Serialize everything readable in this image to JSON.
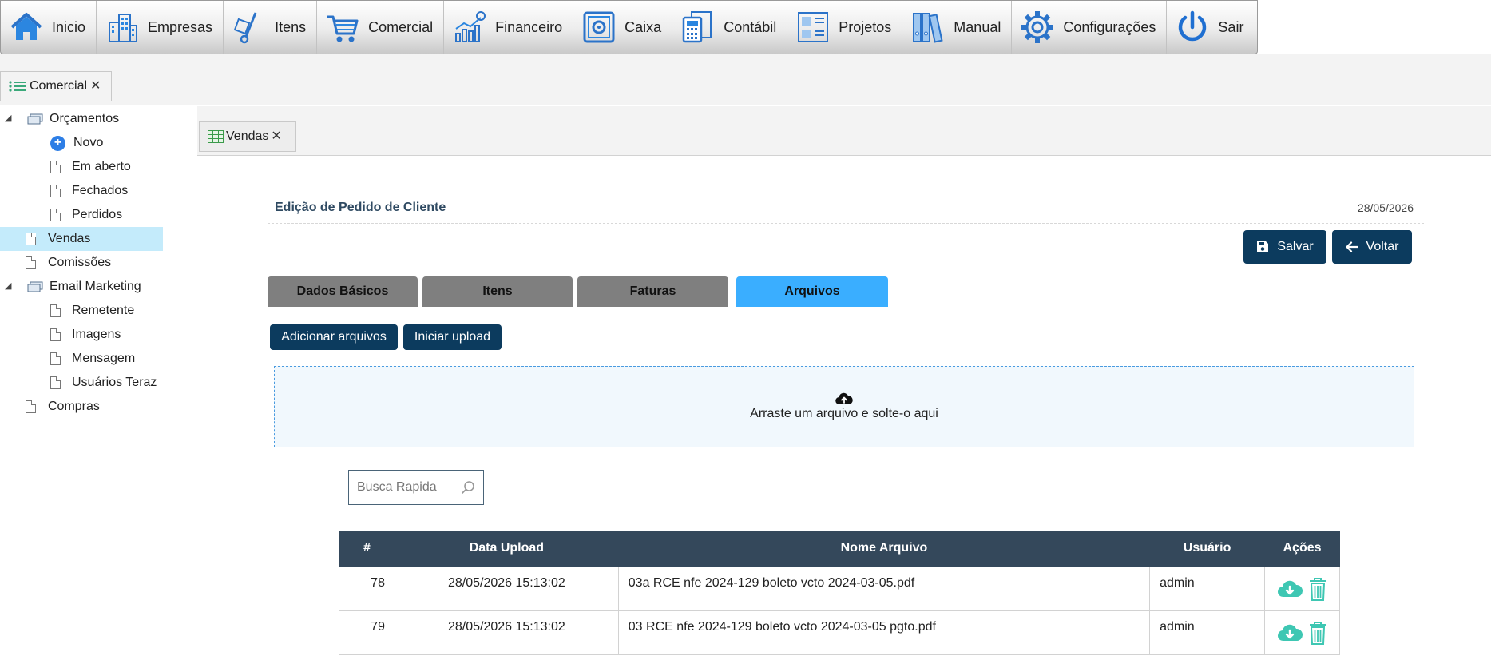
{
  "menu": [
    {
      "label": "Inicio",
      "icon": "home-icon"
    },
    {
      "label": "Empresas",
      "icon": "buildings-icon"
    },
    {
      "label": "Itens",
      "icon": "hand-truck-icon"
    },
    {
      "label": "Comercial",
      "icon": "shopping-cart-icon"
    },
    {
      "label": "Financeiro",
      "icon": "finance-chart-icon"
    },
    {
      "label": "Caixa",
      "icon": "safe-icon"
    },
    {
      "label": "Contábil",
      "icon": "calculator-icon"
    },
    {
      "label": "Projetos",
      "icon": "projects-icon"
    },
    {
      "label": "Manual",
      "icon": "binders-icon"
    },
    {
      "label": "Configurações",
      "icon": "gear-icon"
    },
    {
      "label": "Sair",
      "icon": "power-icon"
    }
  ],
  "outer_tab": {
    "label": "Comercial"
  },
  "sidebar": {
    "items": [
      {
        "label": "Orçamentos",
        "icon": "folder-icon"
      },
      {
        "label": "Novo",
        "icon": "plus-circle-icon"
      },
      {
        "label": "Em aberto",
        "icon": "document-icon"
      },
      {
        "label": "Fechados",
        "icon": "document-icon"
      },
      {
        "label": "Perdidos",
        "icon": "document-icon"
      },
      {
        "label": "Vendas",
        "icon": "document-icon"
      },
      {
        "label": "Comissões",
        "icon": "document-icon"
      },
      {
        "label": "Email Marketing",
        "icon": "folder-icon"
      },
      {
        "label": "Remetente",
        "icon": "document-icon"
      },
      {
        "label": "Imagens",
        "icon": "document-icon"
      },
      {
        "label": "Mensagem",
        "icon": "document-icon"
      },
      {
        "label": "Usuários Teraz",
        "icon": "document-icon"
      },
      {
        "label": "Compras",
        "icon": "document-icon"
      }
    ]
  },
  "inner_tab": {
    "label": "Vendas"
  },
  "form": {
    "title": "Edição de Pedido de Cliente",
    "date": "28/05/2026",
    "save_label": "Salvar",
    "back_label": "Voltar"
  },
  "tabs": [
    {
      "label": "Dados Básicos"
    },
    {
      "label": "Itens"
    },
    {
      "label": "Faturas"
    },
    {
      "label": "Arquivos"
    }
  ],
  "upload": {
    "add_label": "Adicionar arquivos",
    "start_label": "Iniciar upload",
    "drop_text": "Arraste um arquivo e solte-o aqui"
  },
  "search": {
    "placeholder": "Busca Rapida"
  },
  "table": {
    "headers": [
      "#",
      "Data Upload",
      "Nome Arquivo",
      "Usuário",
      "Ações"
    ],
    "rows": [
      {
        "id": "78",
        "date": "28/05/2026 15:13:02",
        "name": "03a RCE nfe 2024-129 boleto vcto 2024-03-05.pdf",
        "user": "admin"
      },
      {
        "id": "79",
        "date": "28/05/2026 15:13:02",
        "name": "03 RCE nfe 2024-129 boleto vcto 2024-03-05 pgto.pdf",
        "user": "admin"
      }
    ]
  },
  "colors": {
    "primary_dark": "#0c3b5e",
    "tab_active": "#3aaeff",
    "tab_inactive": "#7f7f7f",
    "table_header": "#34485b",
    "action_teal": "#3ec7b3",
    "selection": "#c4ebfb"
  }
}
